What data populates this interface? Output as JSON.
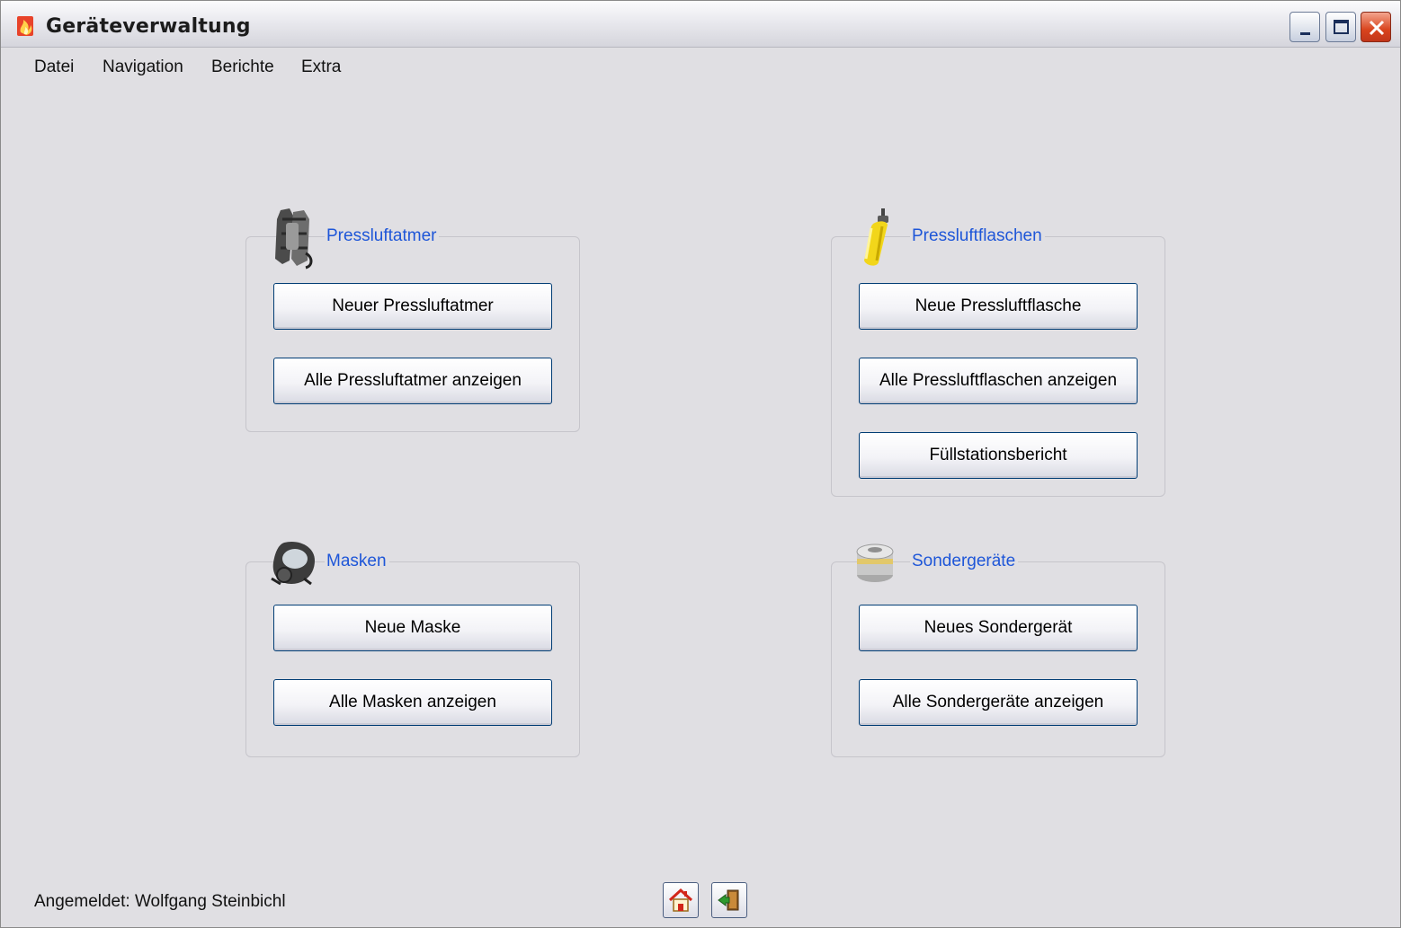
{
  "window": {
    "title": "Geräteverwaltung"
  },
  "menu": {
    "items": [
      "Datei",
      "Navigation",
      "Berichte",
      "Extra"
    ]
  },
  "groups": {
    "pressluftatmer": {
      "title": "Pressluftatmer",
      "icon": "breathing-apparatus-icon",
      "buttons": [
        "Neuer Pressluftatmer",
        "Alle Pressluftatmer anzeigen"
      ]
    },
    "pressluftflaschen": {
      "title": "Pressluftflaschen",
      "icon": "air-cylinder-icon",
      "buttons": [
        "Neue Pressluftflasche",
        "Alle Pressluftflaschen anzeigen",
        "Füllstationsbericht"
      ]
    },
    "masken": {
      "title": "Masken",
      "icon": "gas-mask-icon",
      "buttons": [
        "Neue Maske",
        "Alle Masken anzeigen"
      ]
    },
    "sondergeraete": {
      "title": "Sondergeräte",
      "icon": "filter-canister-icon",
      "buttons": [
        "Neues Sondergerät",
        "Alle Sondergeräte anzeigen"
      ]
    }
  },
  "status": {
    "logged_in": "Angemeldet: Wolfgang Steinbichl"
  },
  "footer_icons": [
    "home-icon",
    "exit-door-icon"
  ]
}
